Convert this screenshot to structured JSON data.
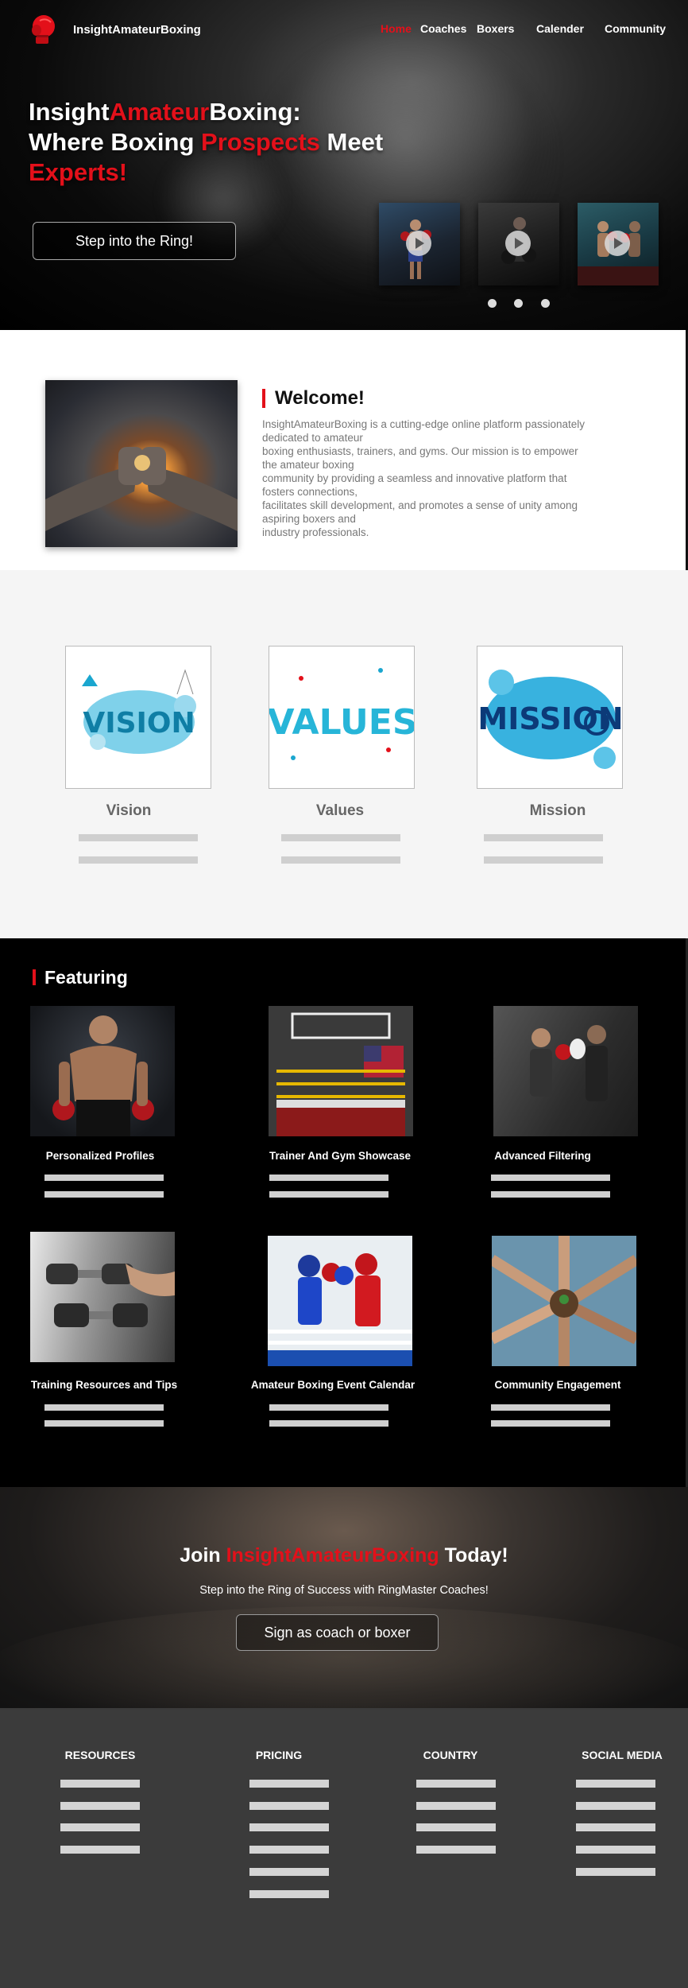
{
  "header": {
    "brand": "InsightAmateurBoxing",
    "nav": [
      {
        "label": "Home",
        "active": true
      },
      {
        "label": "Coaches",
        "active": false
      },
      {
        "label": "Boxers",
        "active": false
      },
      {
        "label": "Calender",
        "active": false
      },
      {
        "label": "Community",
        "active": false
      }
    ]
  },
  "hero": {
    "title_line1_a": "Insight",
    "title_line1_b": "Amateur",
    "title_line1_c": "Boxing:",
    "title_line2_a": "Where Boxing ",
    "title_line2_b": "Prospects",
    "title_line2_c": " Meet",
    "title_line3": "Experts!",
    "cta_label": "Step into the Ring!",
    "carousel": {
      "slides": 3,
      "active_index": 0
    }
  },
  "welcome": {
    "title": "Welcome!",
    "text_lines": [
      "InsightAmateurBoxing is a cutting-edge online platform passionately",
      "dedicated to amateur",
      "boxing enthusiasts, trainers, and gyms. Our mission is to empower",
      "the amateur boxing",
      "community by providing a seamless and innovative platform that",
      "fosters connections,",
      "facilitates skill development, and promotes a sense of unity among",
      "aspiring boxers and",
      "industry professionals."
    ]
  },
  "values_section": {
    "cards": [
      {
        "image_text": "VISION",
        "label": "Vision"
      },
      {
        "image_text": "VALUES",
        "label": "Values"
      },
      {
        "image_text": "MISSION",
        "label": "Mission"
      }
    ]
  },
  "featuring": {
    "title": "Featuring",
    "items": [
      {
        "label": "Personalized Profiles"
      },
      {
        "label": "Trainer And Gym Showcase"
      },
      {
        "label": "Advanced Filtering"
      },
      {
        "label": "Training Resources and Tips"
      },
      {
        "label": "Amateur Boxing Event Calendar"
      },
      {
        "label": "Community Engagement"
      }
    ]
  },
  "join": {
    "title_a": "Join ",
    "title_b": "InsightAmateurBoxing",
    "title_c": " Today!",
    "subtitle": "Step into the Ring of Success with RingMaster Coaches!",
    "cta_label": "Sign as coach or boxer"
  },
  "footer": {
    "columns": [
      {
        "heading": "RESOURCES",
        "items": 4
      },
      {
        "heading": "PRICING",
        "items": 6
      },
      {
        "heading": "COUNTRY",
        "items": 4
      },
      {
        "heading": "SOCIAL MEDIA",
        "items": 5
      }
    ]
  },
  "colors": {
    "accent": "#e3101a",
    "dark": "#000000",
    "footer": "#3b3b3b",
    "placeholder_bar": "#cfcfcf"
  }
}
